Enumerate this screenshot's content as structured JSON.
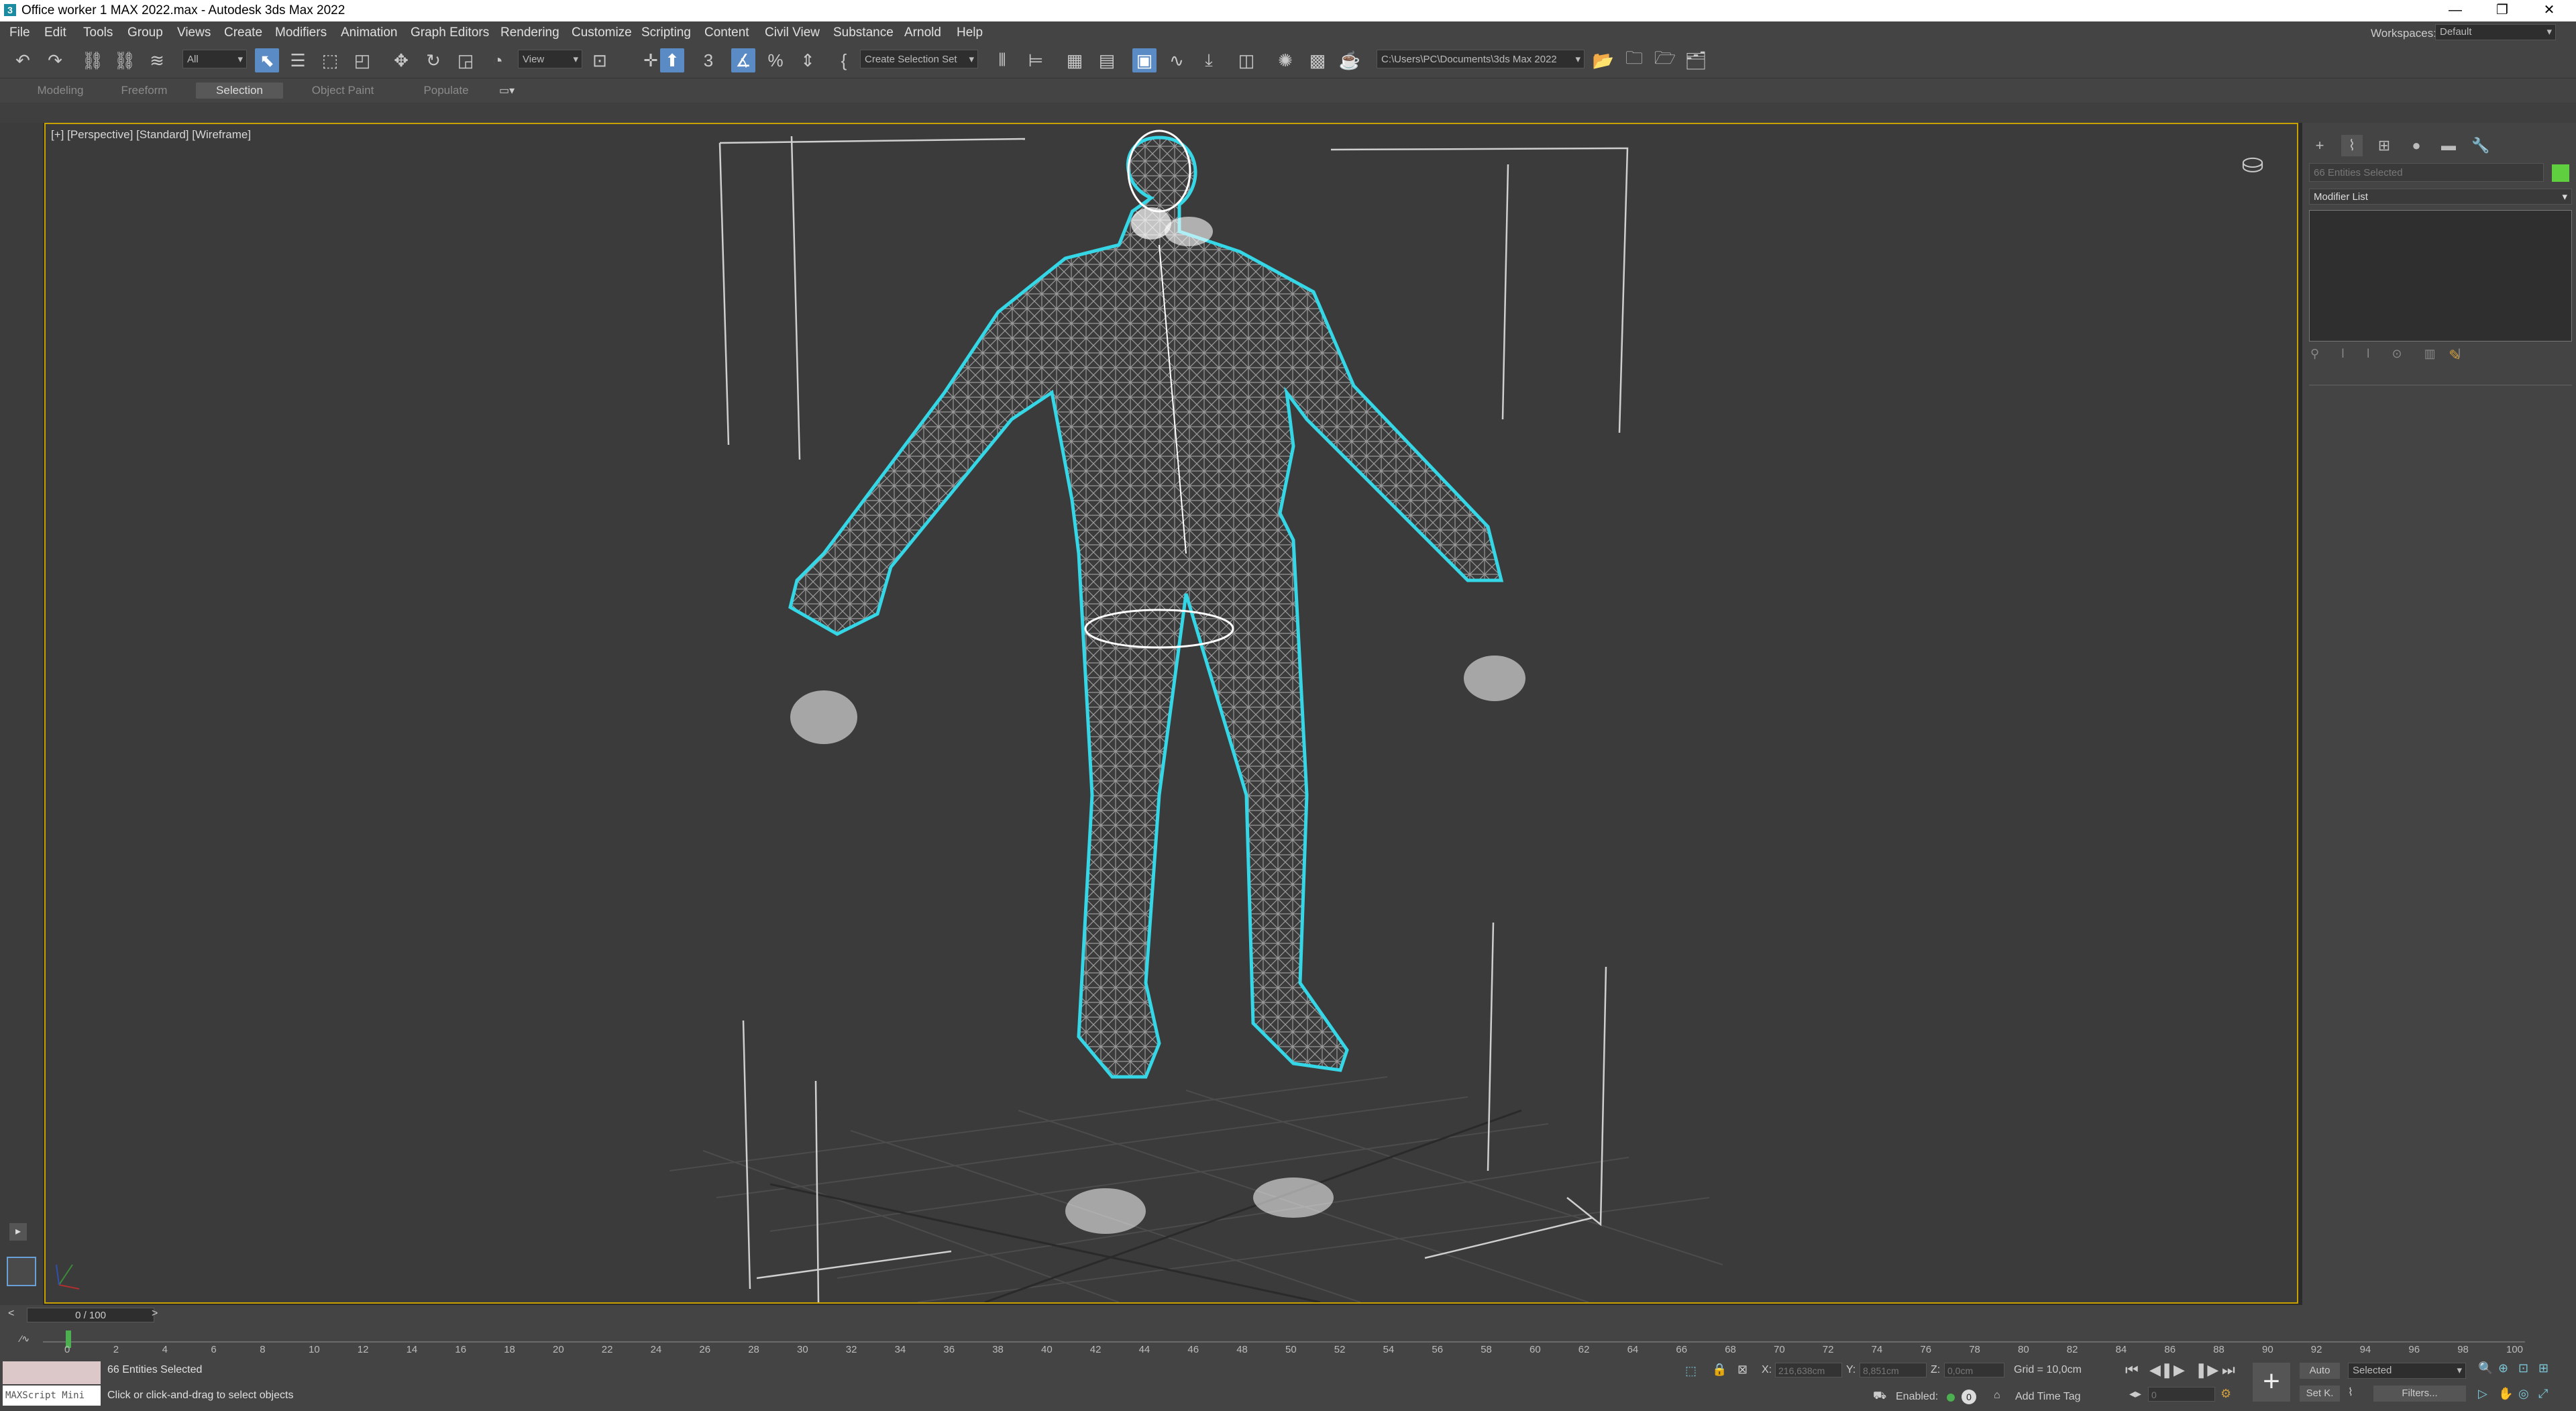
{
  "window": {
    "title": "Office worker 1 MAX 2022.max - Autodesk 3ds Max 2022",
    "minimize": "—",
    "restore": "❐",
    "close": "✕"
  },
  "menu": {
    "items": [
      "File",
      "Edit",
      "Tools",
      "Group",
      "Views",
      "Create",
      "Modifiers",
      "Animation",
      "Graph Editors",
      "Rendering",
      "Customize",
      "Scripting",
      "Content",
      "Civil View",
      "Substance",
      "Arnold",
      "Help"
    ],
    "workspaces_label": "Workspaces:",
    "workspaces_value": "Default"
  },
  "toolbar": {
    "filter_value": "All",
    "refcoord_value": "View",
    "selection_set_placeholder": "Create Selection Set",
    "project_path": "C:\\Users\\PC\\Documents\\3ds Max 2022"
  },
  "ribbon": {
    "tabs": [
      "Modeling",
      "Freeform",
      "Selection",
      "Object Paint",
      "Populate"
    ],
    "selected_tab": "Selection"
  },
  "viewport": {
    "label": "[+] [Perspective] [Standard] [Wireframe]",
    "wire_color": "#ffffff",
    "selection_outline_color": "#35d6e6",
    "border_color": "#c8a000"
  },
  "command_panel": {
    "selection_name": "66 Entities Selected",
    "object_color": "#5fcf40",
    "modifier_list": "Modifier List"
  },
  "timeline": {
    "frame_display": "0 / 100",
    "ticks": [
      "0",
      "2",
      "4",
      "6",
      "8",
      "10",
      "12",
      "14",
      "16",
      "18",
      "20",
      "22",
      "24",
      "26",
      "28",
      "30",
      "32",
      "34",
      "36",
      "38",
      "40",
      "42",
      "44",
      "46",
      "48",
      "50",
      "52",
      "54",
      "56",
      "58",
      "60",
      "62",
      "64",
      "66",
      "68",
      "70",
      "72",
      "74",
      "76",
      "78",
      "80",
      "82",
      "84",
      "86",
      "88",
      "90",
      "92",
      "94",
      "96",
      "98",
      "100"
    ]
  },
  "status": {
    "maxscript_placeholder": "MAXScript Mini",
    "selected_text": "66 Entities Selected",
    "prompt_text": "Click or click-and-drag to select objects",
    "x_label": "X:",
    "x_value": "216,638cm",
    "y_label": "Y:",
    "y_value": "8,851cm",
    "z_label": "Z:",
    "z_value": "0,0cm",
    "grid": "Grid = 10,0cm",
    "enabled_label": "Enabled:",
    "add_time_tag": "Add Time Tag",
    "auto_label": "Auto",
    "selected_dropdown": "Selected",
    "set_key_label": "Set K.",
    "filters_label": "Filters...",
    "frame_field": "0"
  }
}
